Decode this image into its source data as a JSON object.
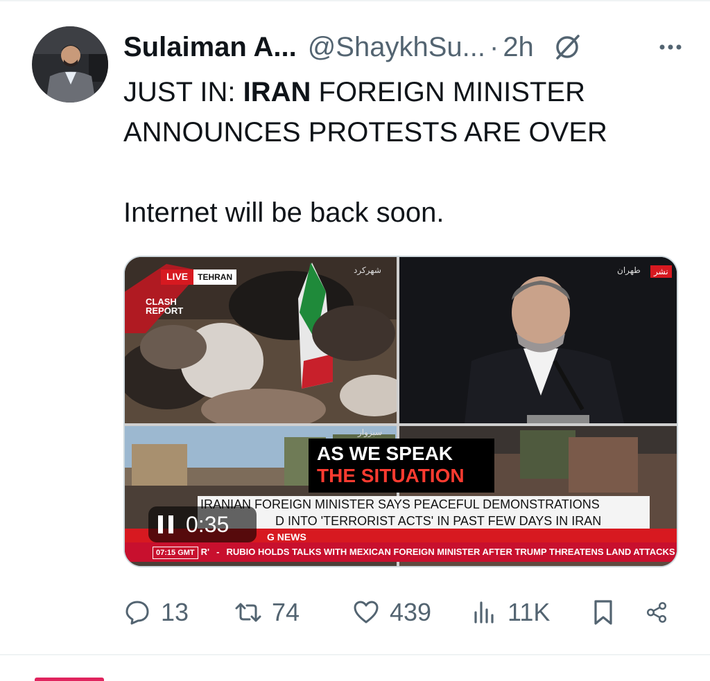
{
  "tweet": {
    "author_name": "Sulaiman A...",
    "handle": "@ShaykhSu...",
    "separator": "·",
    "time": "2h",
    "text_prefix": "JUST IN: ",
    "text_bold": "IRAN",
    "text_rest": " FOREIGN MINISTER ANNOUNCES PROTESTS ARE OVER",
    "text_second": "Internet will be back soon."
  },
  "media": {
    "live_label": "LIVE",
    "city_label": "TEHRAN",
    "brand_line1": "CLASH",
    "brand_line2": "REPORT",
    "fa_top_left": "شهرکرد",
    "fa_top_right": "طهران",
    "fa_tag": "نشر",
    "fa_bottom_left": "سبزوار",
    "caption_line1": "AS WE SPEAK",
    "caption_line2": "THE SITUATION",
    "strap_line1": "IRANIAN FOREIGN MINISTER SAYS PEACEFUL DEMONSTRATIONS",
    "strap_line2": "D INTO 'TERRORIST ACTS' IN PAST FEW DAYS IN IRAN",
    "breaking_label": "G NEWS",
    "ticker_time": "07:15 GMT",
    "ticker_r": "R'",
    "ticker_dash": "-",
    "ticker_text": "RUBIO HOLDS TALKS WITH MEXICAN FOREIGN MINISTER AFTER TRUMP THREATENS LAND ATTACKS",
    "video_time": "0:35"
  },
  "actions": {
    "replies": "13",
    "reposts": "74",
    "likes": "439",
    "views": "11K"
  },
  "colors": {
    "text": "#0f1419",
    "muted": "#536471",
    "news_red": "#d71920",
    "caption_red": "#ff3b30"
  },
  "icons": [
    "grok-icon",
    "more-icon",
    "pause-icon",
    "reply-icon",
    "repost-icon",
    "like-icon",
    "views-icon",
    "bookmark-icon",
    "share-icon"
  ]
}
